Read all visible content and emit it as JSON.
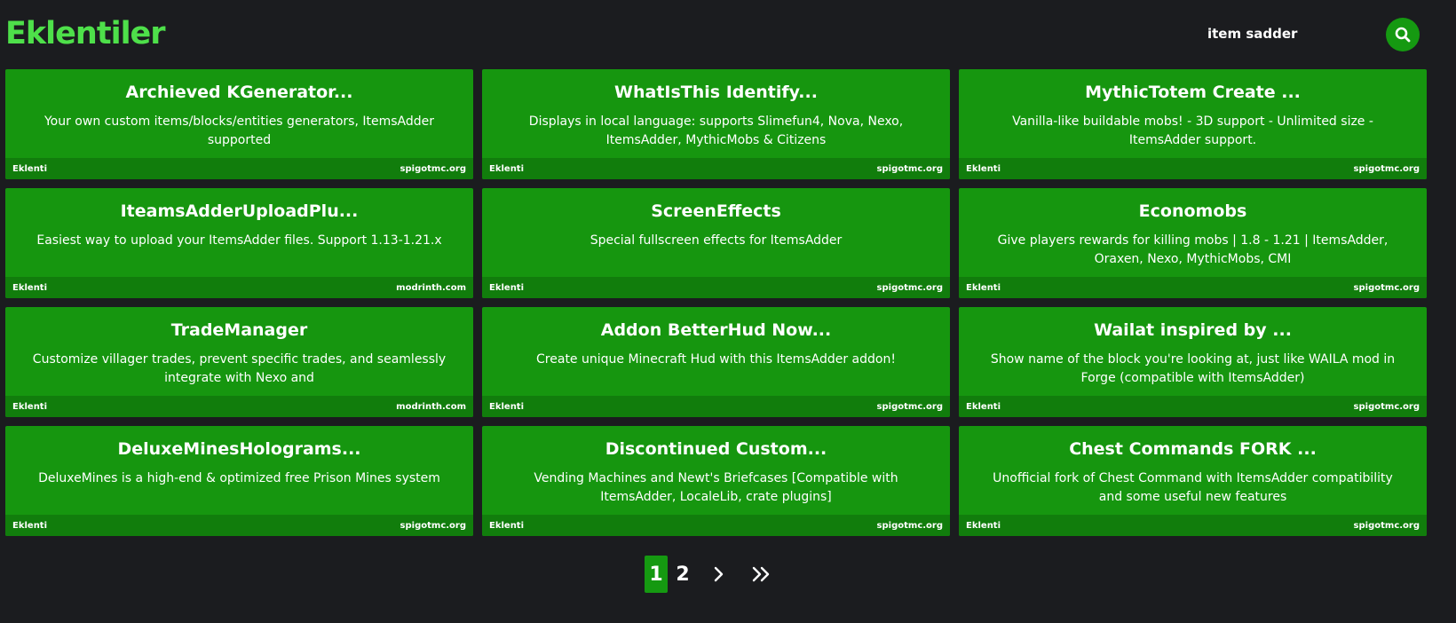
{
  "header": {
    "title": "Eklentiler",
    "search_value": "item sadder",
    "search_icon": "search-icon",
    "accent_color": "#4ee04a"
  },
  "cards": [
    {
      "title": "Archieved KGenerator...",
      "description": "Your own custom items/blocks/entities generators, ItemsAdder supported",
      "type": "Eklenti",
      "source": "spigotmc.org"
    },
    {
      "title": "WhatIsThis Identify...",
      "description": "Displays in local language: supports Slimefun4, Nova, Nexo, ItemsAdder, MythicMobs & Citizens",
      "type": "Eklenti",
      "source": "spigotmc.org"
    },
    {
      "title": "MythicTotem Create ...",
      "description": "Vanilla-like buildable mobs! - 3D support - Unlimited size - ItemsAdder support.",
      "type": "Eklenti",
      "source": "spigotmc.org"
    },
    {
      "title": "IteamsAdderUploadPlu...",
      "description": "Easiest way to upload your ItemsAdder files. Support 1.13-1.21.x",
      "type": "Eklenti",
      "source": "modrinth.com"
    },
    {
      "title": "ScreenEffects",
      "description": "Special fullscreen effects for ItemsAdder",
      "type": "Eklenti",
      "source": "spigotmc.org"
    },
    {
      "title": "Economobs",
      "description": "Give players rewards for killing mobs | 1.8 - 1.21 | ItemsAdder, Oraxen, Nexo, MythicMobs, CMI",
      "type": "Eklenti",
      "source": "spigotmc.org"
    },
    {
      "title": "TradeManager",
      "description": "Customize villager trades, prevent specific trades, and seamlessly integrate with Nexo and",
      "type": "Eklenti",
      "source": "modrinth.com"
    },
    {
      "title": "Addon BetterHud Now...",
      "description": "Create unique Minecraft Hud with this ItemsAdder addon!",
      "type": "Eklenti",
      "source": "spigotmc.org"
    },
    {
      "title": "Wailat inspired by ...",
      "description": "Show name of the block you're looking at, just like WAILA mod in Forge (compatible with ItemsAdder)",
      "type": "Eklenti",
      "source": "spigotmc.org"
    },
    {
      "title": "DeluxeMinesHolograms...",
      "description": "DeluxeMines is a high-end & optimized free Prison Mines system",
      "type": "Eklenti",
      "source": "spigotmc.org"
    },
    {
      "title": "Discontinued Custom...",
      "description": "Vending Machines and Newt's Briefcases [Compatible with ItemsAdder, LocaleLib, crate plugins]",
      "type": "Eklenti",
      "source": "spigotmc.org"
    },
    {
      "title": "Chest Commands FORK ...",
      "description": "Unofficial fork of Chest Command with ItemsAdder compatibility and some useful new features",
      "type": "Eklenti",
      "source": "spigotmc.org"
    }
  ],
  "pagination": {
    "current": "1",
    "next_page": "2",
    "next_icon": "chevron-right-icon",
    "last_icon": "double-chevron-right-icon"
  },
  "colors": {
    "background": "#1b1c1f",
    "card": "#16960f",
    "card_footer": "#117d0c",
    "button": "#159911"
  }
}
